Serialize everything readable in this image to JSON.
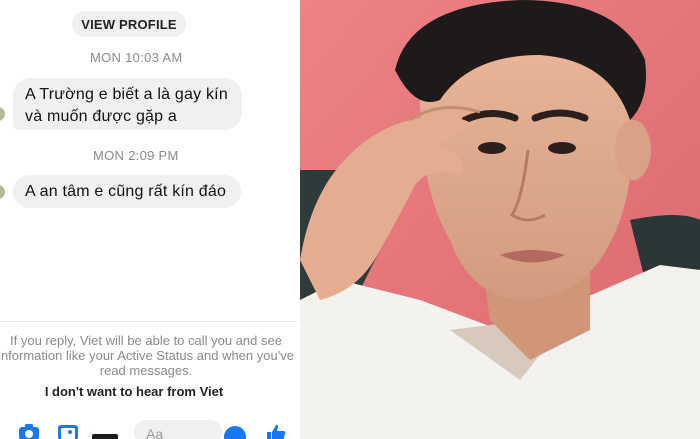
{
  "chat": {
    "view_profile_label": "VIEW PROFILE",
    "messages": [
      {
        "timestamp": "MON 10:03 AM",
        "text": "A Trường e biết a là gay kín và muốn được gặp a"
      },
      {
        "timestamp": "MON 2:09 PM",
        "text": "A an tâm e cũng rất kín đáo"
      }
    ],
    "reply_notice": "If you reply, Viet will be able to call you and see information like your Active Status and when you've read messages.",
    "block_label": "I don't want to hear from Viet",
    "composer_placeholder": "Aa",
    "accent_color": "#1877f2"
  },
  "photo": {
    "background_color": "#e9797d",
    "shirt_color": "#f4f2ee"
  }
}
